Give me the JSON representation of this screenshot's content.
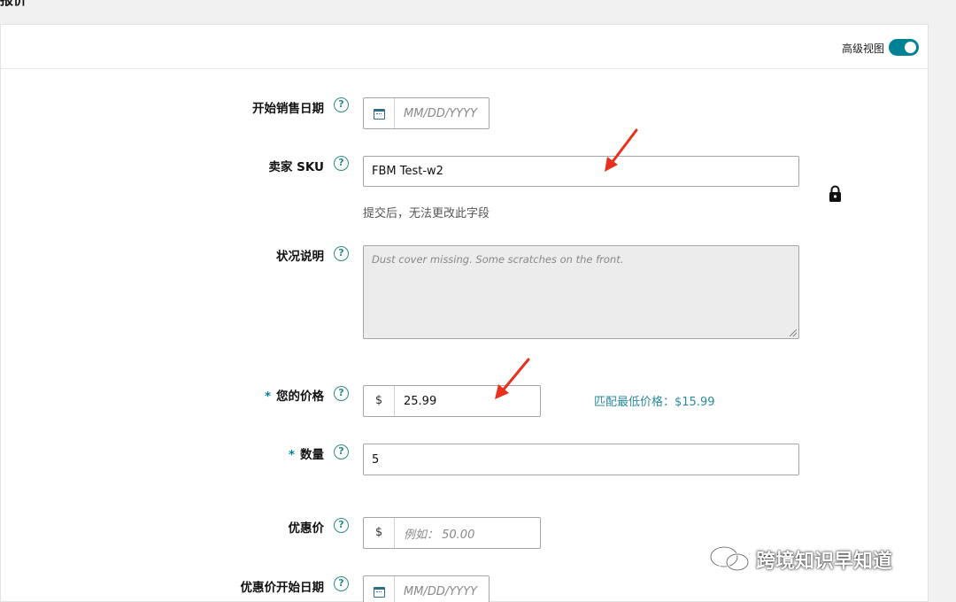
{
  "page": {
    "cut_title": "报价",
    "advanced_view_label": "高级视图",
    "advanced_view_on": true
  },
  "fields": {
    "start_date": {
      "label": "开始销售日期",
      "placeholder": "MM/DD/YYYY"
    },
    "sku": {
      "label": "卖家 SKU",
      "value": "FBM Test-w2",
      "note": "提交后，无法更改此字段"
    },
    "condition": {
      "label": "状况说明",
      "placeholder": "Dust cover missing. Some scratches on the front."
    },
    "price": {
      "required_mark": "*",
      "label": "您的价格",
      "currency": "$",
      "value": "25.99",
      "match_low_price": "匹配最低价格：$15.99"
    },
    "quantity": {
      "required_mark": "*",
      "label": "数量",
      "value": "5"
    },
    "sale_price": {
      "label": "优惠价",
      "currency": "$",
      "placeholder": "例如： 50.00"
    },
    "sale_start_date": {
      "label": "优惠价开始日期",
      "placeholder": "MM/DD/YYYY"
    }
  },
  "watermark": {
    "text": "跨境知识早知道"
  },
  "colors": {
    "accent": "#008296",
    "annotation_arrow": "#e8301c"
  }
}
